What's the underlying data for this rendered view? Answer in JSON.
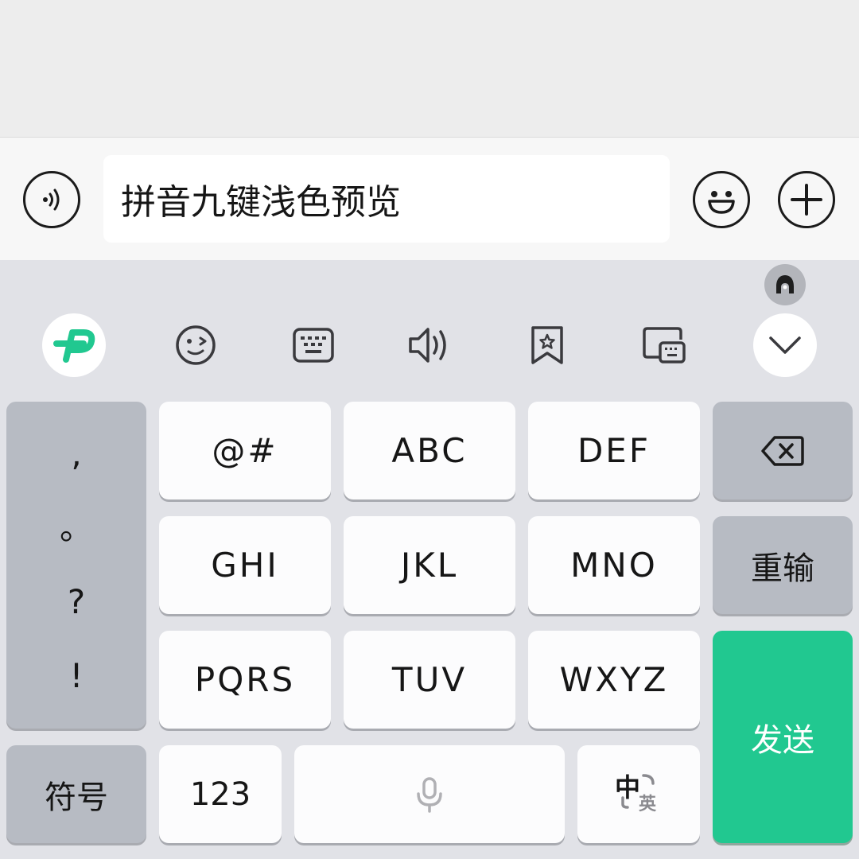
{
  "input_bar": {
    "text_value": "拼音九键浅色预览"
  },
  "keyboard": {
    "punctuation": [
      ",",
      "。",
      "?",
      "!"
    ],
    "keys": {
      "row1": [
        "@#",
        "ABC",
        "DEF"
      ],
      "row2": [
        "GHI",
        "JKL",
        "MNO"
      ],
      "row3": [
        "PQRS",
        "TUV",
        "WXYZ"
      ]
    },
    "reinput_label": "重输",
    "send_label": "发送",
    "symbols_label": "符号",
    "numbers_label": "123",
    "lang_toggle": {
      "primary": "中",
      "secondary": "英"
    }
  },
  "colors": {
    "accent": "#21c890",
    "key_bg": "#fcfcfd",
    "function_key_bg": "#b7bbc3",
    "keyboard_bg": "#e1e2e7"
  },
  "icons": {
    "input_bar": [
      "voice-icon",
      "emoji-icon",
      "plus-icon"
    ],
    "toolbar": [
      "app-logo-icon",
      "wink-emoji-icon",
      "keyboard-icon",
      "speaker-icon",
      "bookmark-star-icon",
      "floating-keyboard-icon",
      "chevron-down-icon"
    ]
  }
}
